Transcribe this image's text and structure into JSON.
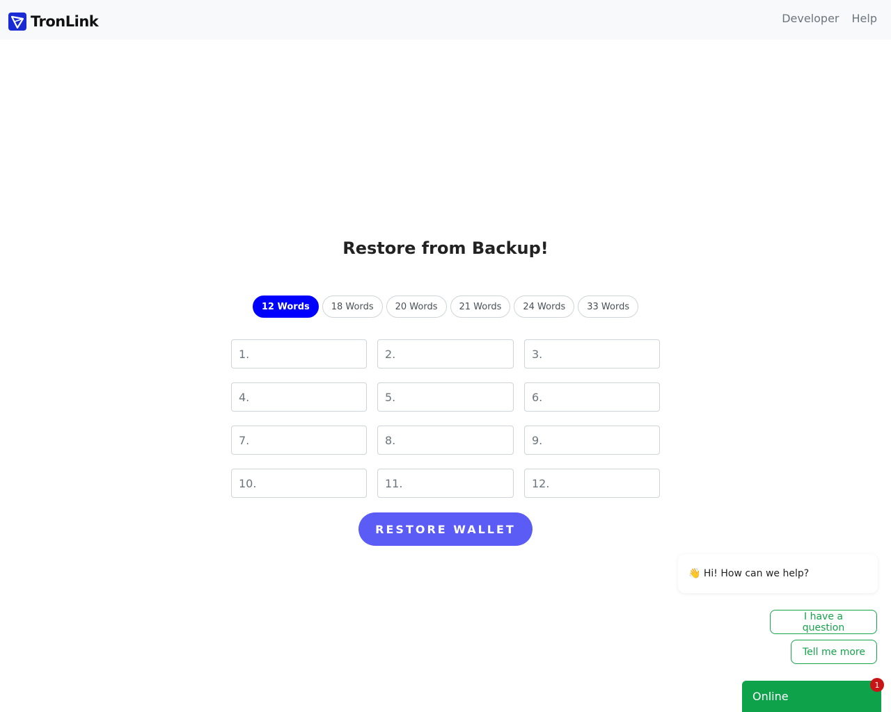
{
  "header": {
    "brand": "TronLink",
    "nav": [
      "Developer",
      "Help"
    ]
  },
  "main": {
    "title": "Restore from Backup!",
    "word_options": [
      "12 Words",
      "18 Words",
      "20 Words",
      "21 Words",
      "24 Words",
      "33 Words"
    ],
    "selected_option": "12 Words",
    "inputs": [
      "1.",
      "2.",
      "3.",
      "4.",
      "5.",
      "6.",
      "7.",
      "8.",
      "9.",
      "10.",
      "11.",
      "12."
    ],
    "restore_label": "RESTORE WALLET"
  },
  "chat": {
    "greeting": "👋 Hi! How can we help?",
    "question_label": "I have a question",
    "more_label": "Tell me more",
    "status": "Online",
    "badge_count": "1"
  },
  "colors": {
    "accent": "#0000ff",
    "button": "#5b5bf5",
    "chat_green": "#0ea34b"
  }
}
